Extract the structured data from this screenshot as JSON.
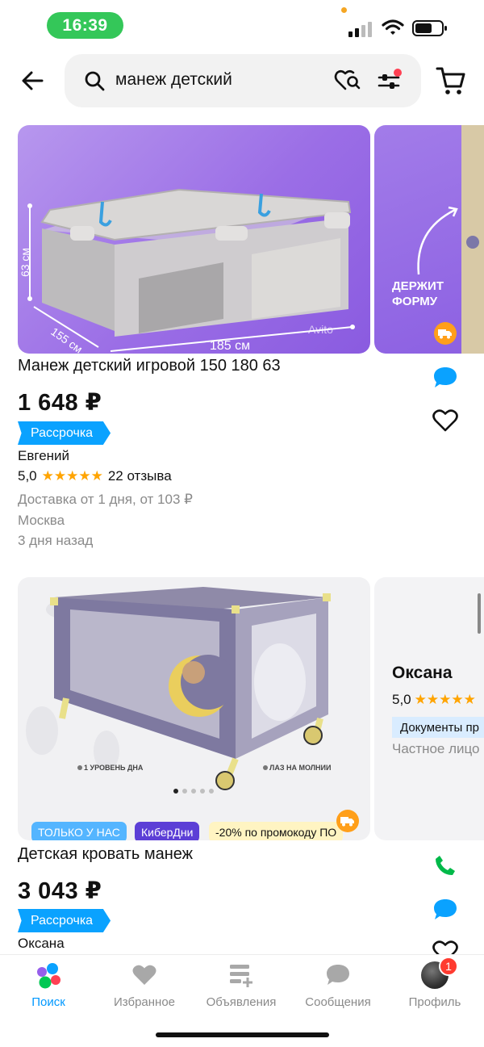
{
  "status_bar": {
    "time": "16:39"
  },
  "search": {
    "query": "манеж детский"
  },
  "listings": [
    {
      "title": "Манеж детский игровой 150 180 63",
      "price": "1 648 ₽",
      "installment": "Рассрочка",
      "seller": "Евгений",
      "rating": "5,0",
      "stars": "★★★★★",
      "reviews": "22 отзыва",
      "delivery": "Доставка от 1 дня, от 103 ₽",
      "location": "Москва",
      "posted": "3 дня назад",
      "image_labels": {
        "height": "63 см",
        "depth": "155 см",
        "width": "185 см",
        "watermark": "Avito"
      },
      "side_image_text": "ДЕРЖИТ\nФОРМУ"
    },
    {
      "title": "Детская кровать манеж",
      "price": "3 043 ₽",
      "installment": "Рассрочка",
      "seller": "Оксана",
      "image_captions": {
        "left": "1 УРОВЕНЬ ДНА",
        "right": "ЛАЗ НА МОЛНИИ"
      },
      "tags": [
        "ТОЛЬКО У НАС",
        "КиберДни",
        "-20% по промокоду ПО"
      ],
      "side_card": {
        "name": "Оксана",
        "rating": "5,0",
        "stars": "★★★★★",
        "docs": "Документы пр",
        "type": "Частное лицо"
      }
    }
  ],
  "bottom_nav": [
    {
      "label": "Поиск",
      "icon": "avito-logo-icon",
      "active": true
    },
    {
      "label": "Избранное",
      "icon": "heart-icon"
    },
    {
      "label": "Объявления",
      "icon": "listings-add-icon"
    },
    {
      "label": "Сообщения",
      "icon": "chat-icon"
    },
    {
      "label": "Профиль",
      "icon": "avatar",
      "badge": "1"
    }
  ],
  "colors": {
    "accent": "#0098ff",
    "installment": "#0aa2ff",
    "star": "#ffa400",
    "status_pill": "#34c759",
    "chat_icon": "#0aa2ff",
    "phone_icon": "#00b949"
  }
}
